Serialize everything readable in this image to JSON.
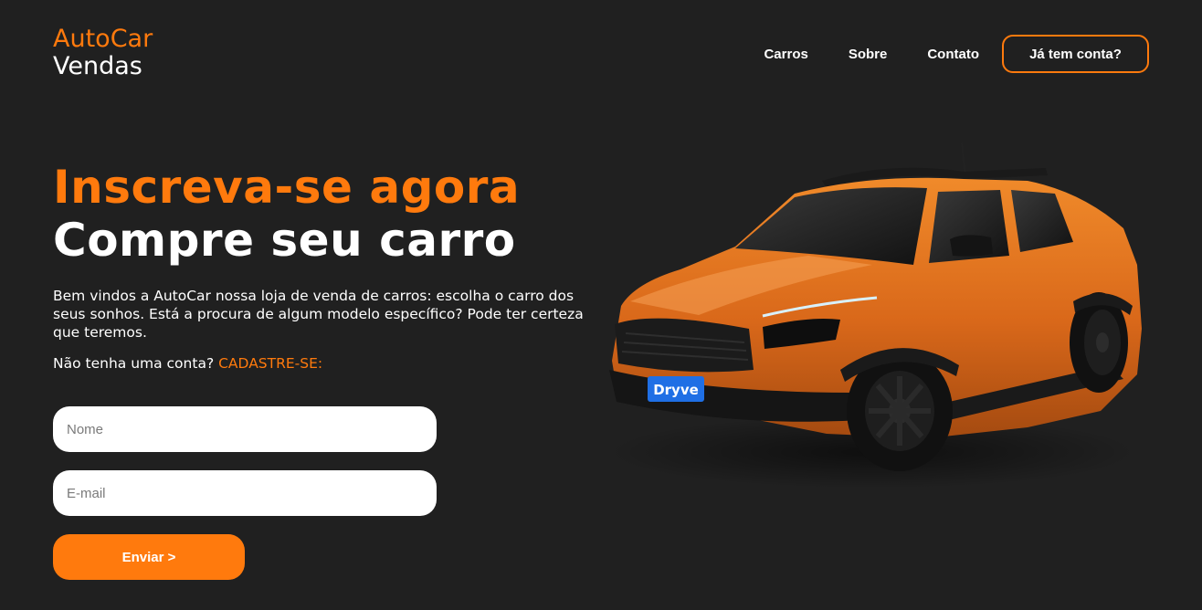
{
  "logo": {
    "line1": "AutoCar",
    "line2": "Vendas"
  },
  "nav": {
    "items": [
      "Carros",
      "Sobre",
      "Contato"
    ],
    "login_button": "Já tem conta?"
  },
  "hero": {
    "headline_orange": "Inscreva-se agora",
    "headline_white": "Compre seu carro",
    "description": "Bem vindos a AutoCar nossa loja de venda de carros: escolha o carro dos seus sonhos. Está a procura de algum modelo específico? Pode ter certeza que teremos.",
    "signup_prompt": "Não tenha uma conta?",
    "signup_link": "CADASTRE-SE:"
  },
  "form": {
    "name_placeholder": "Nome",
    "email_placeholder": "E-mail",
    "submit_label": "Enviar >"
  },
  "car_image": {
    "plate_text": "Dryve"
  },
  "colors": {
    "accent": "#ff7a0d",
    "background": "#202020",
    "text": "#ffffff"
  }
}
